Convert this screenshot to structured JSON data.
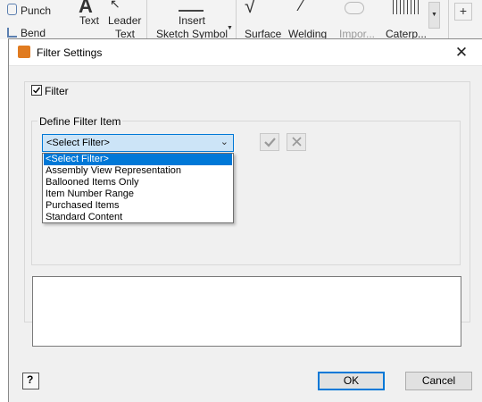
{
  "ribbon": {
    "punch": "Punch",
    "bend": "Bend",
    "text": "Text",
    "leader_line1": "Leader",
    "leader_line2": "Text",
    "insert_line1": "Insert",
    "insert_line2": "Sketch Symbol",
    "surface": "Surface",
    "welding": "Welding",
    "import": "Impor...",
    "caterpillar": "Caterp..."
  },
  "dialog": {
    "title": "Filter Settings",
    "filter_checkbox_label": "Filter",
    "filter_checked": true,
    "group_label": "Define Filter Item",
    "select": {
      "value": "<Select Filter>",
      "options": [
        "<Select Filter>",
        "Assembly View Representation",
        "Ballooned Items Only",
        "Item Number Range",
        "Purchased Items",
        "Standard Content"
      ]
    },
    "ok_label": "OK",
    "cancel_label": "Cancel",
    "help_icon": "?"
  }
}
